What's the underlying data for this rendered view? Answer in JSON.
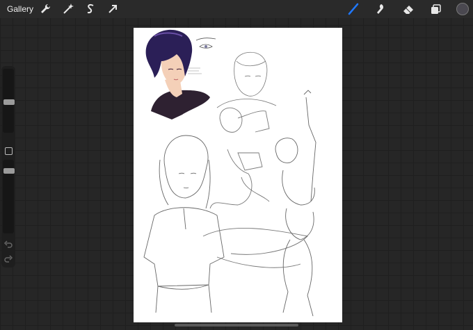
{
  "header": {
    "gallery_label": "Gallery",
    "tools_left": [
      "wrench-icon",
      "magic-wand-icon",
      "selection-icon",
      "transform-arrow-icon"
    ],
    "tools_right": [
      "brush-icon",
      "smudge-icon",
      "eraser-icon",
      "layers-icon"
    ],
    "active_tool": "brush-icon",
    "accent_color": "#1f78ff",
    "current_color": "#4a4850"
  },
  "sidebar": {
    "brush_size_slider": "brush-size-slider",
    "opacity_slider": "opacity-slider",
    "modify_button": "modify-square-icon",
    "undo": "undo-icon",
    "redo": "redo-icon"
  },
  "canvas": {
    "hair_color": "#2b1f57",
    "shirt_color": "#2e2131",
    "skin_color": "#f4d0b8"
  }
}
